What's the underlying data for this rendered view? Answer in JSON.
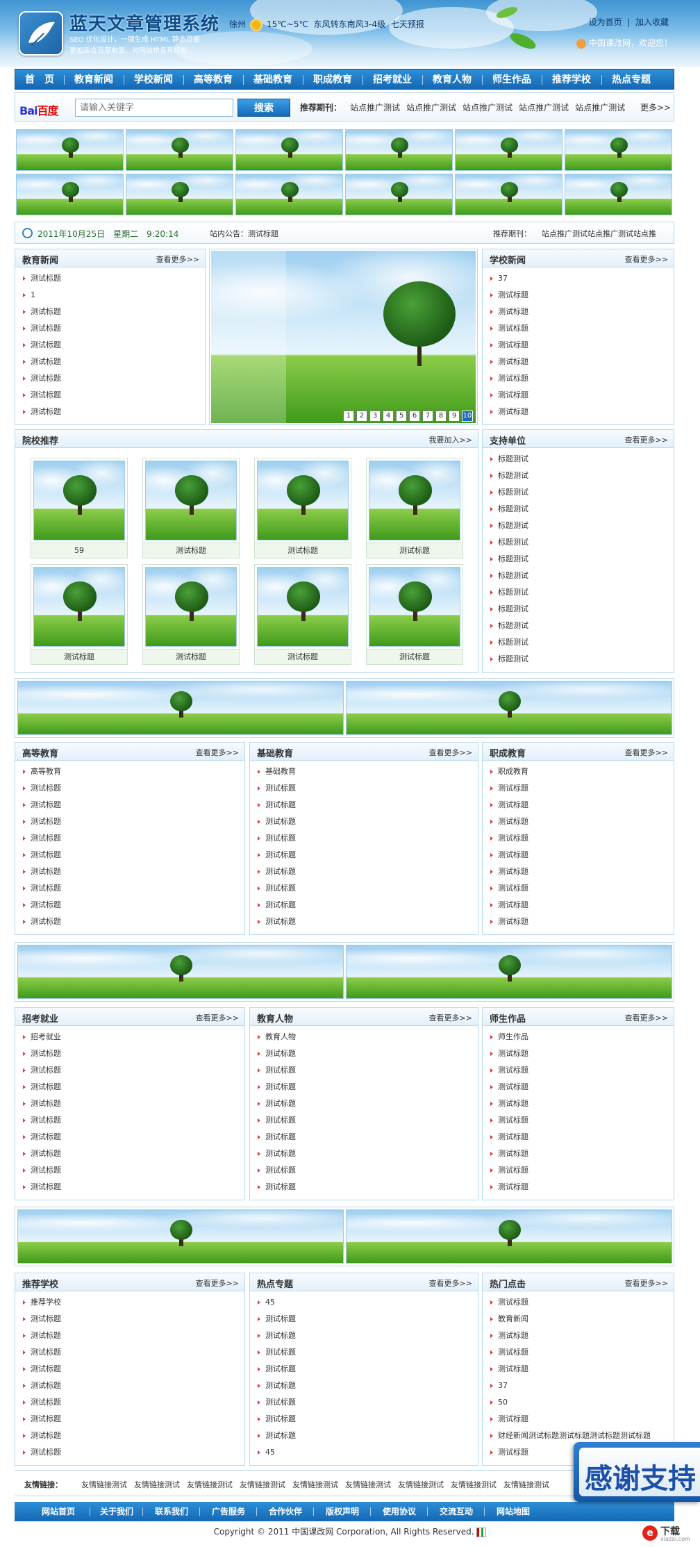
{
  "header": {
    "title": "蓝天文章管理系统",
    "tagline1": "SEO 优化设计，一键生成 HTML 静态页面",
    "tagline2": "更加适合百度收录、对网站排名有好处",
    "city": "徐州",
    "temperature": "15℃~5℃",
    "wind": "东风转东南风3-4级",
    "forecast": "七天预报",
    "set_home": "设为首页",
    "bookmark": "加入收藏",
    "welcome": "中国课改网，欢迎您！"
  },
  "nav": [
    "首　页",
    "教育新闻",
    "学校新闻",
    "高等教育",
    "基础教育",
    "职成教育",
    "招考就业",
    "教育人物",
    "师生作品",
    "推荐学校",
    "热点专题"
  ],
  "search": {
    "logo_bai": "Bai",
    "logo_du": "百度",
    "placeholder": "请输入关键字",
    "button": "搜索",
    "rec_label": "推荐期刊：",
    "rec_items": [
      "站点推广测试",
      "站点推广测试",
      "站点推广测试",
      "站点推广测试",
      "站点推广测试"
    ],
    "more": "更多>>"
  },
  "datebar": {
    "datetime": "2011年10月25日　星期二　9:20:14",
    "notice_label": "站内公告：",
    "notice": "测试标题",
    "rec_label": "推荐期刊：",
    "rec_text": "站点推广测试站点推广测试站点推"
  },
  "more_text": "查看更多>>",
  "join_text": "我要加入>>",
  "edu_news": {
    "title": "教育新闻",
    "items": [
      "测试标题",
      "1",
      "测试标题",
      "测试标题",
      "测试标题",
      "测试标题",
      "测试标题",
      "测试标题",
      "测试标题"
    ]
  },
  "slider_pages": [
    "1",
    "2",
    "3",
    "4",
    "5",
    "6",
    "7",
    "8",
    "9",
    "10"
  ],
  "school_news": {
    "title": "学校新闻",
    "items": [
      "37",
      "测试标题",
      "测试标题",
      "测试标题",
      "测试标题",
      "测试标题",
      "测试标题",
      "测试标题",
      "测试标题"
    ]
  },
  "schools": {
    "title": "院校推荐",
    "captions": [
      "59",
      "测试标题",
      "测试标题",
      "测试标题",
      "测试标题",
      "测试标题",
      "测试标题",
      "测试标题"
    ]
  },
  "support": {
    "title": "支持单位",
    "items": [
      "标题测试",
      "标题测试",
      "标题测试",
      "标题测试",
      "标题测试",
      "标题测试",
      "标题测试",
      "标题测试",
      "标题测试",
      "标题测试",
      "标题测试",
      "标题测试",
      "标题测试"
    ]
  },
  "row1": [
    {
      "title": "高等教育",
      "items": [
        "高等教育",
        "测试标题",
        "测试标题",
        "测试标题",
        "测试标题",
        "测试标题",
        "测试标题",
        "测试标题",
        "测试标题",
        "测试标题"
      ]
    },
    {
      "title": "基础教育",
      "items": [
        "基础教育",
        "测试标题",
        "测试标题",
        "测试标题",
        "测试标题",
        "测试标题",
        "测试标题",
        "测试标题",
        "测试标题",
        "测试标题"
      ]
    },
    {
      "title": "职成教育",
      "items": [
        "职成教育",
        "测试标题",
        "测试标题",
        "测试标题",
        "测试标题",
        "测试标题",
        "测试标题",
        "测试标题",
        "测试标题",
        "测试标题"
      ]
    }
  ],
  "row2": [
    {
      "title": "招考就业",
      "items": [
        "招考就业",
        "测试标题",
        "测试标题",
        "测试标题",
        "测试标题",
        "测试标题",
        "测试标题",
        "测试标题",
        "测试标题",
        "测试标题"
      ]
    },
    {
      "title": "教育人物",
      "items": [
        "教育人物",
        "测试标题",
        "测试标题",
        "测试标题",
        "测试标题",
        "测试标题",
        "测试标题",
        "测试标题",
        "测试标题",
        "测试标题"
      ]
    },
    {
      "title": "师生作品",
      "items": [
        "师生作品",
        "测试标题",
        "测试标题",
        "测试标题",
        "测试标题",
        "测试标题",
        "测试标题",
        "测试标题",
        "测试标题",
        "测试标题"
      ]
    }
  ],
  "row3": [
    {
      "title": "推荐学校",
      "items": [
        "推荐学校",
        "测试标题",
        "测试标题",
        "测试标题",
        "测试标题",
        "测试标题",
        "测试标题",
        "测试标题",
        "测试标题",
        "测试标题"
      ]
    },
    {
      "title": "热点专题",
      "items": [
        "45",
        "测试标题",
        "测试标题",
        "测试标题",
        "测试标题",
        "测试标题",
        "测试标题",
        "测试标题",
        "测试标题",
        "45"
      ]
    },
    {
      "title": "热门点击",
      "items": [
        "测试标题",
        "教育新闻",
        "测试标题",
        "测试标题",
        "测试标题",
        "37",
        "50",
        "测试标题",
        "财经新闻测试标题测试标题测试标题测试标题",
        "测试标题"
      ]
    }
  ],
  "friend": {
    "label": "友情链接：",
    "items": [
      "友情链接测试",
      "友情链接测试",
      "友情链接测试",
      "友情链接测试",
      "友情链接测试",
      "友情链接测试",
      "友情链接测试",
      "友情链接测试",
      "友情链接测试"
    ]
  },
  "footer_nav": [
    "网站首页",
    "关于我们",
    "联系我们",
    "广告服务",
    "合作伙伴",
    "版权声明",
    "使用协议",
    "交流互动",
    "网站地图"
  ],
  "copyright": "Copyright © 2011 中国课改网 Corporation, All Rights Reserved.",
  "thanks_text": "感谢支持",
  "download_badge": {
    "big": "下载",
    "small": "xiazai.com"
  }
}
